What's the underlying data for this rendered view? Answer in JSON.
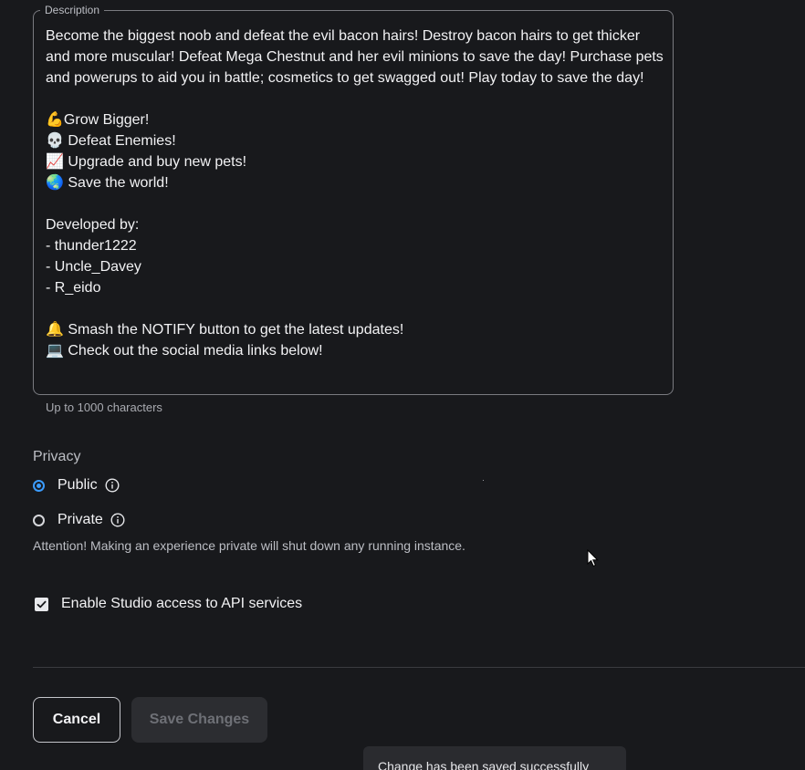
{
  "description": {
    "legend": "Description",
    "text": "Become the biggest noob and defeat the evil bacon hairs! Destroy bacon hairs to get thicker and more muscular! Defeat Mega Chestnut and her evil minions to save the day! Purchase pets and powerups to aid you in battle; cosmetics to get swagged out! Play today to save the day!\n\n💪Grow Bigger!\n💀 Defeat Enemies!\n📈 Upgrade and buy new pets!\n🌏 Save the world!\n\nDeveloped by:\n- thunder1222\n- Uncle_Davey\n- R_eido\n\n🔔 Smash the NOTIFY button to get the latest updates!\n💻 Check out the social media links below!",
    "hint": "Up to 1000 characters"
  },
  "privacy": {
    "label": "Privacy",
    "options": [
      {
        "label": "Public",
        "selected": true
      },
      {
        "label": "Private",
        "selected": false
      }
    ],
    "attention": "Attention! Making an experience private will shut down any running instance."
  },
  "studio_access": {
    "label": "Enable Studio access to API services",
    "checked": true
  },
  "buttons": {
    "cancel": "Cancel",
    "save": "Save Changes"
  },
  "toast": {
    "message": "Change has been saved successfully"
  },
  "colors": {
    "background": "#18191c",
    "accent": "#3b9cff",
    "text": "#f2f2f4",
    "muted": "#bcbec4"
  }
}
